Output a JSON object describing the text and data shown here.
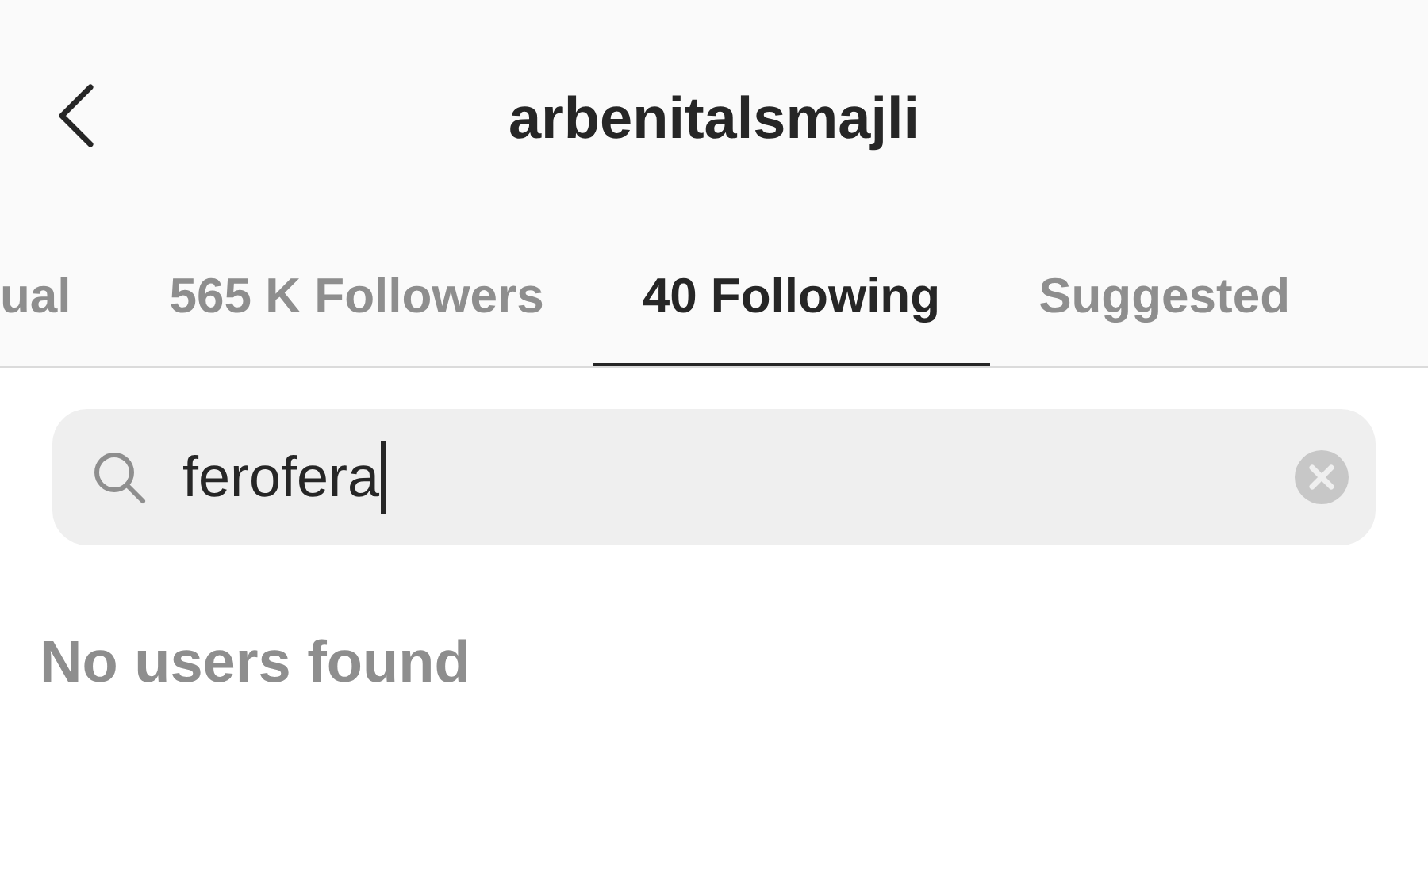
{
  "header": {
    "title": "arbenitalsmajli"
  },
  "tabs": [
    {
      "label": "ual",
      "selected": false
    },
    {
      "label": "565 K Followers",
      "selected": false
    },
    {
      "label": "40 Following",
      "selected": true
    },
    {
      "label": "Suggested",
      "selected": false
    }
  ],
  "search": {
    "value": "ferofera"
  },
  "empty_message": "No users found"
}
